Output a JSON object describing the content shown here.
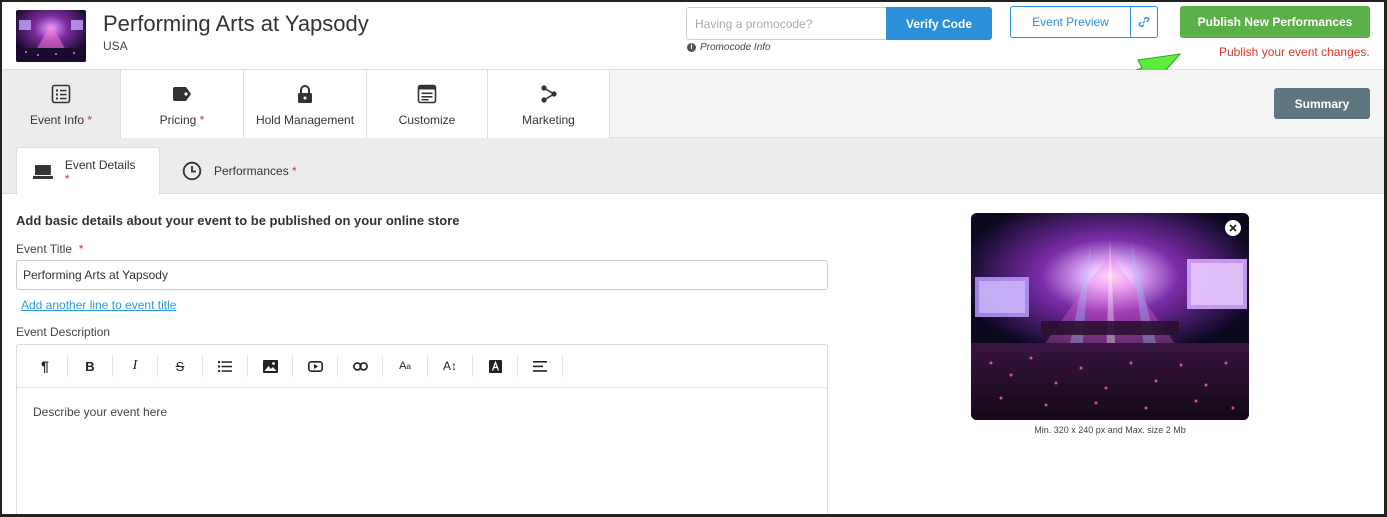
{
  "header": {
    "event_name": "Performing Arts at Yapsody",
    "country": "USA",
    "promo_placeholder": "Having a promocode?",
    "verify_label": "Verify Code",
    "promo_info": "Promocode Info",
    "preview_label": "Event Preview",
    "publish_label": "Publish New Performances",
    "publish_note": "Publish your event changes."
  },
  "main_tabs": [
    {
      "label": "Event Info",
      "required": "*",
      "icon": "list-icon"
    },
    {
      "label": "Pricing",
      "required": "*",
      "icon": "tag-icon"
    },
    {
      "label": "Hold Management",
      "required": "",
      "icon": "lock-icon"
    },
    {
      "label": "Customize",
      "required": "",
      "icon": "browser-window-icon"
    },
    {
      "label": "Marketing",
      "required": "",
      "icon": "share-icon"
    }
  ],
  "summary_label": "Summary",
  "sub_tabs": [
    {
      "label": "Event Details",
      "required": "*",
      "icon": "laptop-icon"
    },
    {
      "label": "Performances",
      "required": "*",
      "icon": "clock-icon"
    }
  ],
  "content": {
    "heading": "Add basic details about your event to be published on your online store",
    "title_label": "Event Title",
    "title_required": "*",
    "title_value": "Performing Arts at Yapsody",
    "add_line": "Add another line to event title",
    "description_label": "Event Description",
    "description_placeholder": "Describe your event here",
    "image_caption": "Min. 320 x 240 px and Max. size 2 Mb"
  },
  "toolbar_tools": [
    "paragraph-icon",
    "bold-icon",
    "italic-icon",
    "strikethrough-icon",
    "list-icon",
    "image-icon",
    "video-icon",
    "link-icon",
    "font-size-icon",
    "line-height-icon",
    "text-color-icon",
    "align-icon"
  ],
  "colors": {
    "accent_blue": "#2b8fd9",
    "publish_green": "#5cb048",
    "required_red": "#d9342b",
    "summary_gray": "#5f7580"
  }
}
